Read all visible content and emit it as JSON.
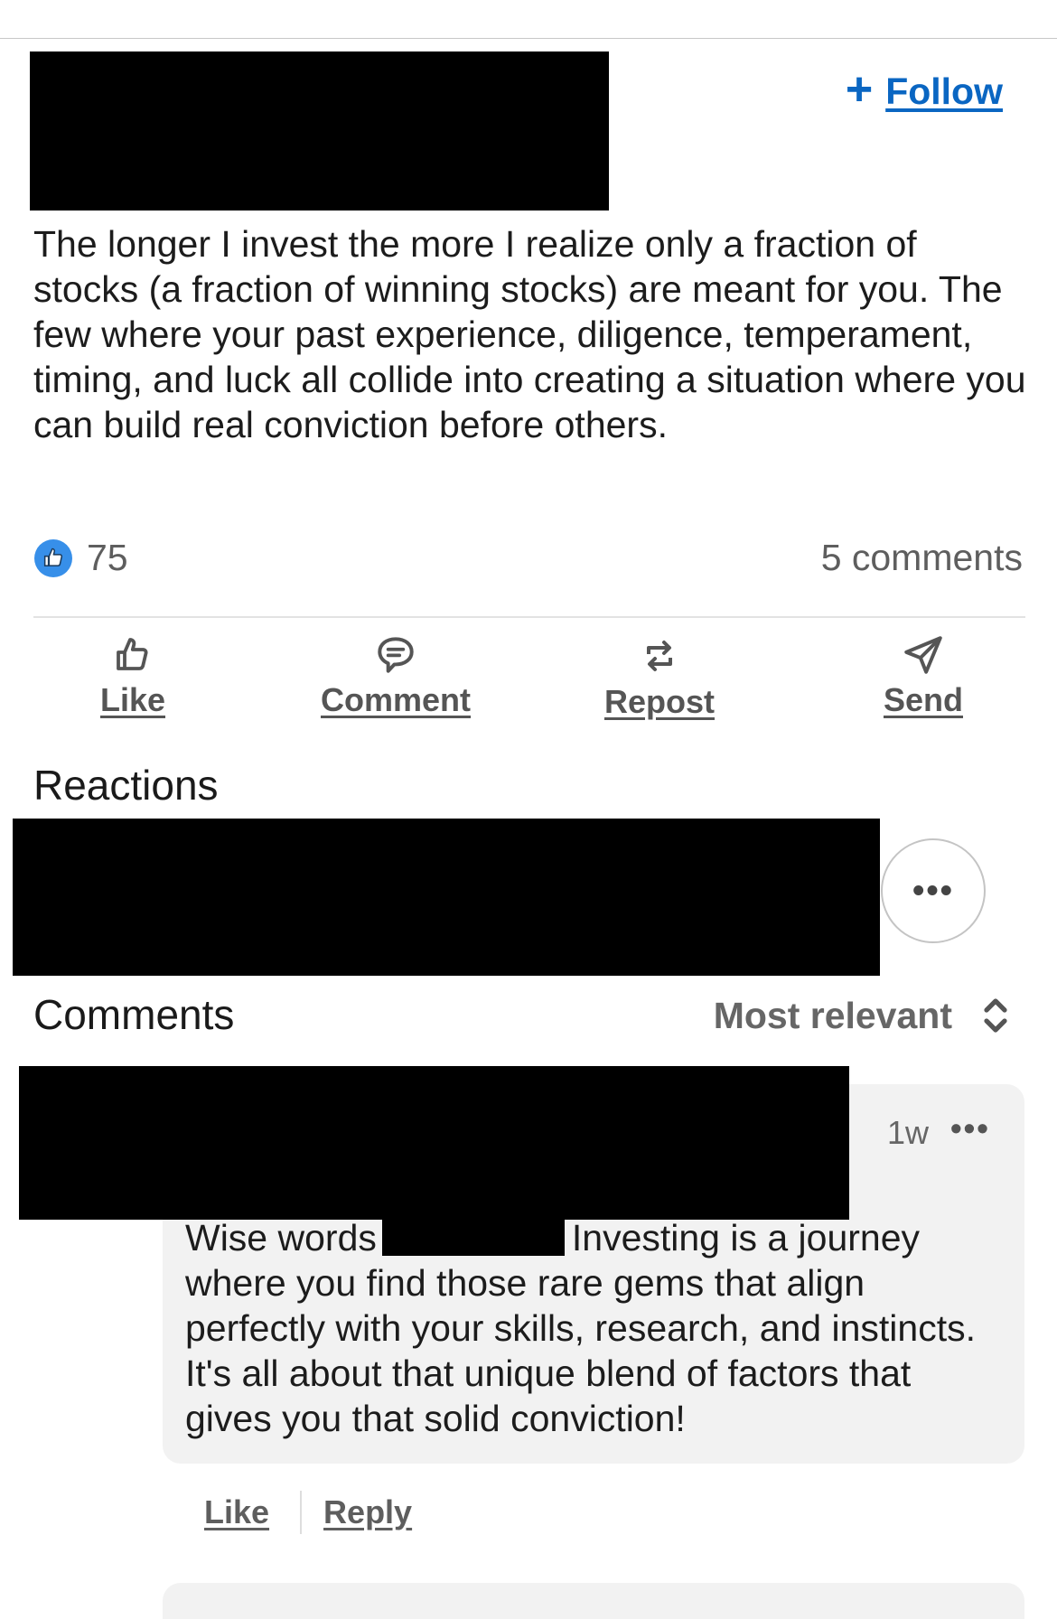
{
  "post": {
    "follow_label": "Follow",
    "follow_plus": "+",
    "body": "The longer I invest the more I realize only a fraction of stocks (a fraction of winning stocks) are meant for you. The few where your past experience, diligence, temperament, timing, and luck all collide into creating a situation where you can build real conviction before others.",
    "reaction_count": "75",
    "comments_count": "5 comments"
  },
  "actions": [
    {
      "label": "Like",
      "icon": "like-icon"
    },
    {
      "label": "Comment",
      "icon": "comment-icon"
    },
    {
      "label": "Repost",
      "icon": "repost-icon"
    },
    {
      "label": "Send",
      "icon": "send-icon"
    }
  ],
  "reactions": {
    "heading": "Reactions",
    "more": "•••"
  },
  "comments": {
    "heading": "Comments",
    "sort_label": "Most relevant",
    "items": [
      {
        "time": "1w",
        "more": "•••",
        "text_before": "Wise words",
        "text_after": "Investing is a journey where you find those rare gems that align perfectly with your skills, research, and instincts. It's all about that unique blend of factors that gives you that solid conviction!",
        "like_label": "Like",
        "reply_label": "Reply"
      }
    ]
  },
  "colors": {
    "link_blue": "#0a66c2",
    "reaction_blue": "#378fe9",
    "muted_text": "#5e5e5e",
    "bubble_bg": "#f2f2f2"
  }
}
